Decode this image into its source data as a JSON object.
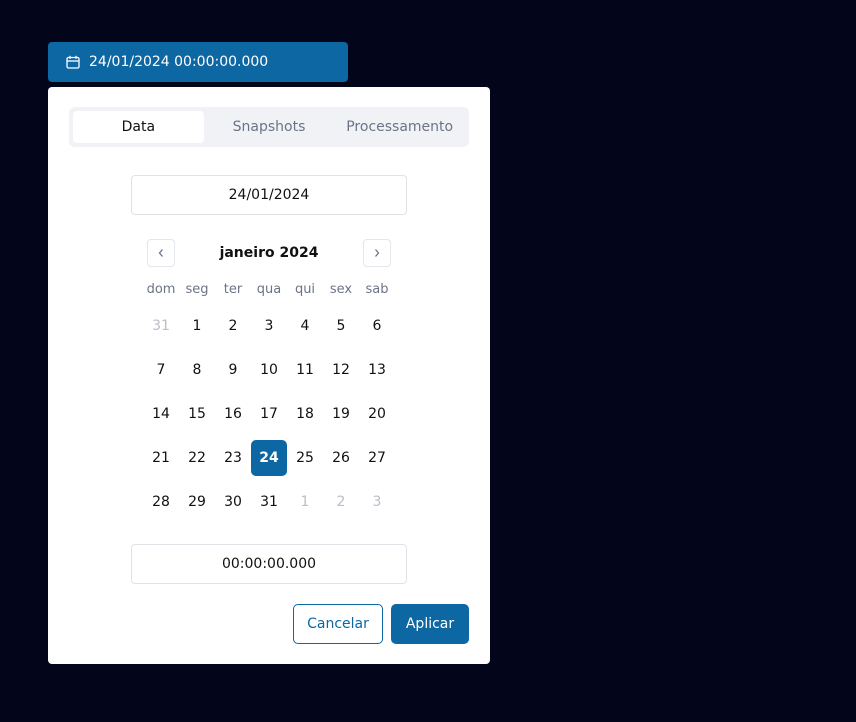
{
  "trigger": {
    "value": "24/01/2024 00:00:00.000",
    "icon": "calendar-icon"
  },
  "tabs": [
    {
      "label": "Data",
      "active": true
    },
    {
      "label": "Snapshots",
      "active": false
    },
    {
      "label": "Processamento",
      "active": false
    }
  ],
  "date_input": {
    "value": "24/01/2024"
  },
  "calendar": {
    "month_label": "janeiro 2024",
    "prev_icon": "chevron-left-icon",
    "next_icon": "chevron-right-icon",
    "weekdays": [
      "dom",
      "seg",
      "ter",
      "qua",
      "qui",
      "sex",
      "sab"
    ],
    "days": [
      {
        "label": "31",
        "muted": true
      },
      {
        "label": "1"
      },
      {
        "label": "2"
      },
      {
        "label": "3"
      },
      {
        "label": "4"
      },
      {
        "label": "5"
      },
      {
        "label": "6"
      },
      {
        "label": "7"
      },
      {
        "label": "8"
      },
      {
        "label": "9"
      },
      {
        "label": "10"
      },
      {
        "label": "11"
      },
      {
        "label": "12"
      },
      {
        "label": "13"
      },
      {
        "label": "14"
      },
      {
        "label": "15"
      },
      {
        "label": "16"
      },
      {
        "label": "17"
      },
      {
        "label": "18"
      },
      {
        "label": "19"
      },
      {
        "label": "20"
      },
      {
        "label": "21"
      },
      {
        "label": "22"
      },
      {
        "label": "23"
      },
      {
        "label": "24",
        "selected": true
      },
      {
        "label": "25"
      },
      {
        "label": "26"
      },
      {
        "label": "27"
      },
      {
        "label": "28"
      },
      {
        "label": "29"
      },
      {
        "label": "30"
      },
      {
        "label": "31"
      },
      {
        "label": "1",
        "muted": true
      },
      {
        "label": "2",
        "muted": true
      },
      {
        "label": "3",
        "muted": true
      }
    ]
  },
  "time_input": {
    "value": "00:00:00.000"
  },
  "actions": {
    "cancel_label": "Cancelar",
    "apply_label": "Aplicar"
  },
  "colors": {
    "accent": "#0c67a3",
    "background": "#03061a",
    "muted_text": "#6b7487"
  }
}
